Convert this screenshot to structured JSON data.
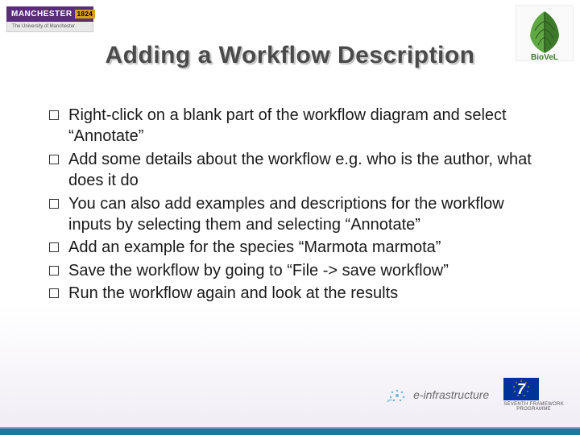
{
  "logos": {
    "manchester": {
      "name": "MANCHESTER",
      "year": "1824",
      "sub": "The University of Manchester"
    },
    "biovel": {
      "name": "BioVeL"
    },
    "einfra": {
      "text": "e-infrastructure"
    },
    "fp7": {
      "line1": "SEVENTH FRAMEWORK",
      "line2": "PROGRAMME"
    }
  },
  "title": "Adding a Workflow Description",
  "bullets": [
    "Right-click on a blank part of the workflow diagram and select “Annotate”",
    "Add some details about the workflow e.g. who is the author, what does it do",
    "You can also add examples and descriptions for the workflow inputs by selecting them and selecting “Annotate”",
    "Add an example for the species “Marmota marmota”",
    "Save the workflow by going to “File -> save workflow”",
    "Run the workflow again and look at the results"
  ]
}
